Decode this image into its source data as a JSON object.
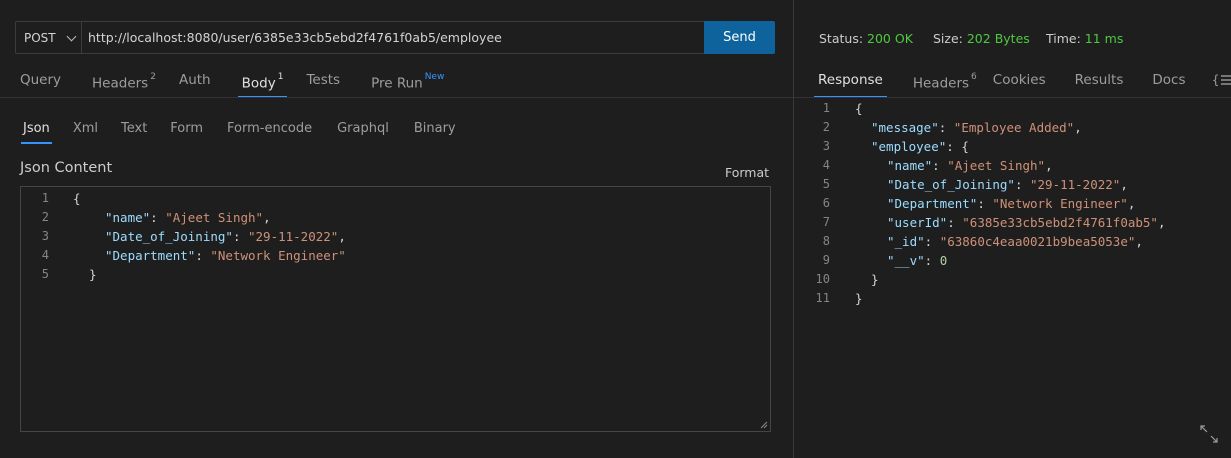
{
  "request": {
    "method": "POST",
    "url": "http://localhost:8080/user/6385e33cb5ebd2f4761f0ab5/employee",
    "send_label": "Send"
  },
  "request_tabs": [
    {
      "label": "Query"
    },
    {
      "label": "Headers",
      "badge": "2"
    },
    {
      "label": "Auth"
    },
    {
      "label": "Body",
      "badge": "1"
    },
    {
      "label": "Tests"
    },
    {
      "label": "Pre Run",
      "badge": "New"
    }
  ],
  "body_tabs": [
    "Json",
    "Xml",
    "Text",
    "Form",
    "Form-encode",
    "Graphql",
    "Binary"
  ],
  "json_content_label": "Json Content",
  "format_label": "Format",
  "request_body": {
    "line1": "{",
    "line2_key": "\"name\"",
    "line2_val": "\"Ajeet Singh\"",
    "line3_key": "\"Date_of_Joining\"",
    "line3_val": "\"29-11-2022\"",
    "line4_key": "\"Department\"",
    "line4_val": "\"Network Engineer\"",
    "line5": "}"
  },
  "line_numbers_req": [
    "1",
    "2",
    "3",
    "4",
    "5"
  ],
  "status": {
    "status_label": "Status:",
    "status_value": "200 OK",
    "size_label": "Size:",
    "size_value": "202 Bytes",
    "time_label": "Time:",
    "time_value": "11 ms"
  },
  "response_tabs": [
    {
      "label": "Response"
    },
    {
      "label": "Headers",
      "badge": "6"
    },
    {
      "label": "Cookies"
    },
    {
      "label": "Results"
    },
    {
      "label": "Docs"
    }
  ],
  "response_body": {
    "l1": "{",
    "l2_key": "\"message\"",
    "l2_val": "\"Employee Added\"",
    "l3_key": "\"employee\"",
    "l3_rest": ": {",
    "l4_key": "\"name\"",
    "l4_val": "\"Ajeet Singh\"",
    "l5_key": "\"Date_of_Joining\"",
    "l5_val": "\"29-11-2022\"",
    "l6_key": "\"Department\"",
    "l6_val": "\"Network Engineer\"",
    "l7_key": "\"userId\"",
    "l7_val": "\"6385e33cb5ebd2f4761f0ab5\"",
    "l8_key": "\"_id\"",
    "l8_val": "\"63860c4eaa0021b9bea5053e\"",
    "l9_key": "\"__v\"",
    "l9_val": "0",
    "l10": "}",
    "l11": "}"
  },
  "line_numbers_res": [
    "1",
    "2",
    "3",
    "4",
    "5",
    "6",
    "7",
    "8",
    "9",
    "10",
    "11"
  ],
  "colors": {
    "accent": "#3794ff",
    "send_button": "#0e639c",
    "status_ok": "#4ec940",
    "json_key": "#9cdcfe",
    "json_string": "#ce9178",
    "json_number": "#b5cea8"
  },
  "icons": [
    "chevron-down-icon",
    "json-format-icon",
    "expand-icon",
    "resize-handle-icon"
  ]
}
